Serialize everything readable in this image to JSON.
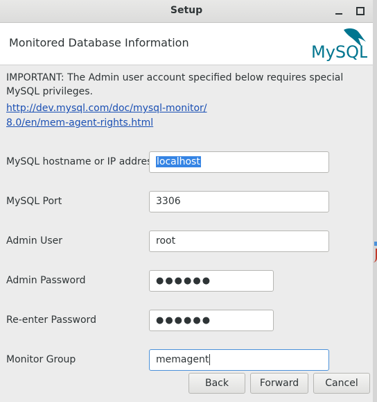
{
  "window": {
    "title": "Setup"
  },
  "header": {
    "heading": "Monitored Database Information",
    "logo_text": "MySQL"
  },
  "notice": {
    "text": "IMPORTANT: The Admin user account specified below requires special MySQL privileges.",
    "link_line1": "http://dev.mysql.com/doc/mysql-monitor/",
    "link_line2": "8.0/en/mem-agent-rights.html"
  },
  "form": {
    "hostname_label": "MySQL hostname or IP address",
    "hostname_value": "localhost",
    "port_label": "MySQL Port",
    "port_value": "3306",
    "admin_user_label": "Admin User",
    "admin_user_value": "root",
    "admin_password_label": "Admin Password",
    "admin_password_value": "●●●●●●",
    "reenter_password_label": "Re-enter Password",
    "reenter_password_value": "●●●●●●",
    "monitor_group_label": "Monitor Group",
    "monitor_group_value": "memagent"
  },
  "buttons": {
    "back": "Back",
    "forward": "Forward",
    "cancel": "Cancel"
  },
  "colors": {
    "accent": "#3584e4",
    "link": "#1a4fb3",
    "logo_blue": "#00758f",
    "logo_orange": "#f29111"
  }
}
